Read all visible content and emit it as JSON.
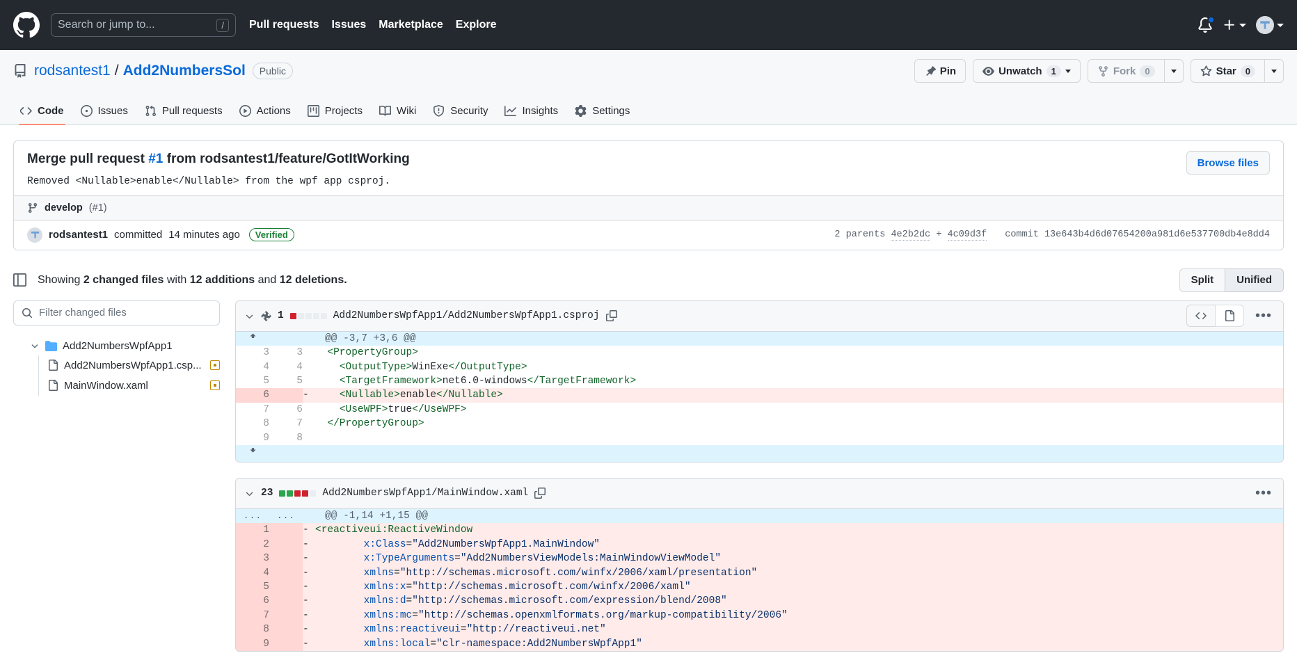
{
  "header": {
    "logo_icon": "github-mark-icon",
    "search": {
      "placeholder": "Search or jump to...",
      "shortcut": "/"
    },
    "nav": [
      {
        "label": "Pull requests"
      },
      {
        "label": "Issues"
      },
      {
        "label": "Marketplace"
      },
      {
        "label": "Explore"
      }
    ],
    "notifications_icon": "bell-icon",
    "create_icon": "plus-icon",
    "avatar_icon": "user-avatar-icon"
  },
  "repo": {
    "icon": "repo-icon",
    "owner": "rodsantest1",
    "separator": "/",
    "name": "Add2NumbersSol",
    "visibility": "Public",
    "actions": {
      "pin": "Pin",
      "unwatch": "Unwatch",
      "unwatch_count": "1",
      "fork": "Fork",
      "fork_count": "0",
      "star": "Star",
      "star_count": "0"
    },
    "tabs": [
      {
        "label": "Code",
        "icon": "code-icon",
        "active": true
      },
      {
        "label": "Issues",
        "icon": "issue-opened-icon",
        "active": false
      },
      {
        "label": "Pull requests",
        "icon": "git-pull-request-icon",
        "active": false
      },
      {
        "label": "Actions",
        "icon": "play-icon",
        "active": false
      },
      {
        "label": "Projects",
        "icon": "project-icon",
        "active": false
      },
      {
        "label": "Wiki",
        "icon": "book-icon",
        "active": false
      },
      {
        "label": "Security",
        "icon": "shield-icon",
        "active": false
      },
      {
        "label": "Insights",
        "icon": "graph-icon",
        "active": false
      },
      {
        "label": "Settings",
        "icon": "gear-icon",
        "active": false
      }
    ]
  },
  "commit": {
    "title_prefix": "Merge pull request ",
    "title_link": "#1",
    "title_suffix": " from rodsantest1/feature/GotItWorking",
    "description": "Removed <Nullable>enable</Nullable> from the wpf app csproj.",
    "browse_files": "Browse files",
    "branch_icon": "git-branch-icon",
    "branch": "develop",
    "branch_pr": "(#1)",
    "author": "rodsantest1",
    "action_text": "committed",
    "time": "14 minutes ago",
    "verified": "Verified",
    "parents_label": "2 parents",
    "parent_a": "4e2b2dc",
    "parent_plus": "+",
    "parent_b": "4c09d3f",
    "commit_label": "commit",
    "commit_sha": "13e643b4d6d07654200a981d6e537700db4e8dd4"
  },
  "files_summary": {
    "sidebar_icon": "sidebar-expand-icon",
    "text_showing": "Showing",
    "changed_files": "2 changed files",
    "text_with": "with",
    "additions": "12 additions",
    "text_and": "and",
    "deletions": "12 deletions.",
    "view_split": "Split",
    "view_unified": "Unified"
  },
  "file_tree": {
    "filter_placeholder": "Filter changed files",
    "folder": "Add2NumbersWpfApp1",
    "files": [
      {
        "name": "Add2NumbersWpfApp1.csp...",
        "status": "modified"
      },
      {
        "name": "MainWindow.xaml",
        "status": "modified"
      }
    ]
  },
  "diff_files": [
    {
      "change_count": "1",
      "bars": [
        "r",
        "n",
        "n",
        "n",
        "n"
      ],
      "path": "Add2NumbersWpfApp1/Add2NumbersWpfApp1.csproj",
      "copy_icon": "copy-icon",
      "view_code_icon": "code-icon",
      "view_file_icon": "file-icon",
      "kebab_icon": "kebab-horizontal-icon",
      "hunk": "@@ -3,7 +3,6 @@",
      "rows": [
        {
          "type": "hunk",
          "old": "",
          "new": "",
          "mark": "",
          "code": "@@ -3,7 +3,6 @@"
        },
        {
          "type": "ctx",
          "old": "3",
          "new": "3",
          "mark": "",
          "code": "  <PropertyGroup>"
        },
        {
          "type": "ctx",
          "old": "4",
          "new": "4",
          "mark": "",
          "code": "    <OutputType>WinExe</OutputType>"
        },
        {
          "type": "ctx",
          "old": "5",
          "new": "5",
          "mark": "",
          "code": "    <TargetFramework>net6.0-windows</TargetFramework>"
        },
        {
          "type": "del",
          "old": "6",
          "new": "",
          "mark": "-",
          "code": "    <Nullable>enable</Nullable>"
        },
        {
          "type": "ctx",
          "old": "7",
          "new": "6",
          "mark": "",
          "code": "    <UseWPF>true</UseWPF>"
        },
        {
          "type": "ctx",
          "old": "8",
          "new": "7",
          "mark": "",
          "code": "  </PropertyGroup>"
        },
        {
          "type": "ctx",
          "old": "9",
          "new": "8",
          "mark": "",
          "code": ""
        }
      ]
    },
    {
      "change_count": "23",
      "bars": [
        "g",
        "g",
        "r",
        "r",
        "n"
      ],
      "path": "Add2NumbersWpfApp1/MainWindow.xaml",
      "copy_icon": "copy-icon",
      "kebab_icon": "kebab-horizontal-icon",
      "hunk": "@@ -1,14 +1,15 @@",
      "rows": [
        {
          "type": "hunk",
          "old": "...",
          "new": "...",
          "mark": "",
          "code": "@@ -1,14 +1,15 @@"
        },
        {
          "type": "del",
          "old": "1",
          "new": "",
          "mark": "-",
          "code": "<reactiveui:ReactiveWindow"
        },
        {
          "type": "del",
          "old": "2",
          "new": "",
          "mark": "-",
          "code": "        x:Class=\"Add2NumbersWpfApp1.MainWindow\""
        },
        {
          "type": "del",
          "old": "3",
          "new": "",
          "mark": "-",
          "code": "        x:TypeArguments=\"Add2NumbersViewModels:MainWindowViewModel\""
        },
        {
          "type": "del",
          "old": "4",
          "new": "",
          "mark": "-",
          "code": "        xmlns=\"http://schemas.microsoft.com/winfx/2006/xaml/presentation\""
        },
        {
          "type": "del",
          "old": "5",
          "new": "",
          "mark": "-",
          "code": "        xmlns:x=\"http://schemas.microsoft.com/winfx/2006/xaml\""
        },
        {
          "type": "del",
          "old": "6",
          "new": "",
          "mark": "-",
          "code": "        xmlns:d=\"http://schemas.microsoft.com/expression/blend/2008\""
        },
        {
          "type": "del",
          "old": "7",
          "new": "",
          "mark": "-",
          "code": "        xmlns:mc=\"http://schemas.openxmlformats.org/markup-compatibility/2006\""
        },
        {
          "type": "del",
          "old": "8",
          "new": "",
          "mark": "-",
          "code": "        xmlns:reactiveui=\"http://reactiveui.net\""
        },
        {
          "type": "del",
          "old": "9",
          "new": "",
          "mark": "-",
          "code": "        xmlns:local=\"clr-namespace:Add2NumbersWpfApp1\""
        }
      ]
    }
  ],
  "colors": {
    "header_bg": "#24292f",
    "accent_blue": "#0969da",
    "addition_green": "#2da44e",
    "deletion_red": "#cf222e",
    "tab_active_underline": "#fd8c73",
    "verified_green": "#1a7f37"
  }
}
